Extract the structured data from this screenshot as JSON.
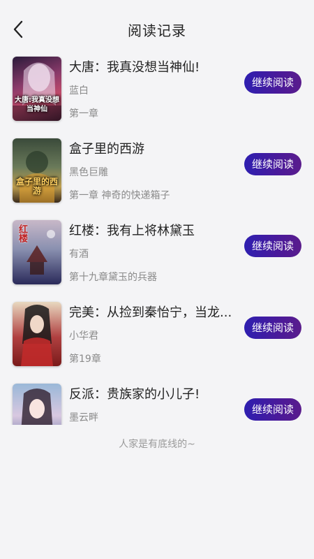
{
  "header": {
    "title": "阅读记录"
  },
  "books": [
    {
      "title": "大唐：我真没想当神仙!",
      "author": "蓝白",
      "chapter": "第一章",
      "button": "继续阅读",
      "cover_text": "大唐:我真没想当神仙"
    },
    {
      "title": "盒子里的西游",
      "author": "黑色巨雕",
      "chapter": "第一章 神奇的快递箱子",
      "button": "继续阅读",
      "cover_text": "盒子里的西游"
    },
    {
      "title": "红楼：我有上将林黛玉",
      "author": "有酒",
      "chapter": "第十九章黛玉的兵器",
      "button": "继续阅读",
      "cover_text": "红楼"
    },
    {
      "title": "完美：从捡到秦怡宁，当龙...",
      "author": "小华君",
      "chapter": "第19章",
      "button": "继续阅读",
      "cover_text": ""
    },
    {
      "title": "反派：贵族家的小儿子!",
      "author": "墨云畔",
      "chapter": "",
      "button": "继续阅读",
      "cover_text": ""
    }
  ],
  "footer": {
    "text": "人家是有底线的~"
  },
  "icons": {
    "back": "chevron-left-icon"
  }
}
